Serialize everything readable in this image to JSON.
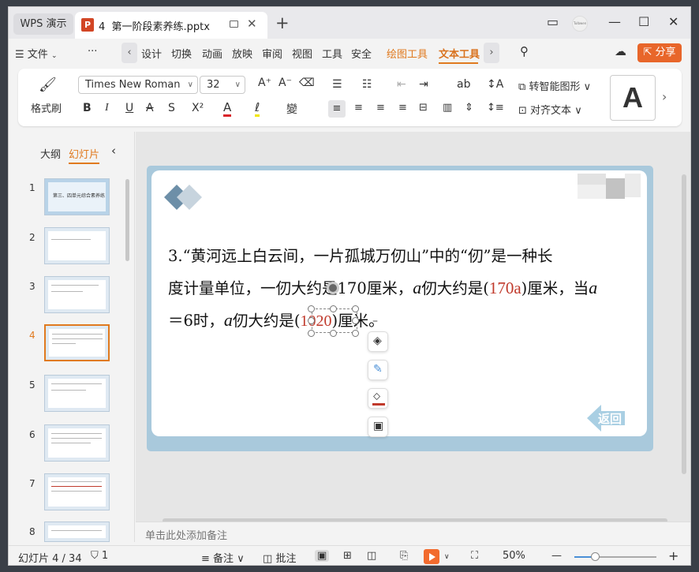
{
  "app": {
    "name": "WPS 演示"
  },
  "tab": {
    "number": "4",
    "title": "第一阶段素养练.pptx",
    "avatar_text": "Tulbwen"
  },
  "menu": {
    "file": "文件",
    "more": "···",
    "items": [
      "设计",
      "切换",
      "动画",
      "放映",
      "审阅",
      "视图",
      "工具",
      "安全"
    ],
    "drawing_tools": "绘图工具",
    "text_tools": "文本工具",
    "share": "分享"
  },
  "ribbon": {
    "format_painter": "格式刷",
    "font": "Times New Roman",
    "size": "32",
    "convert_shape": "转智能图形",
    "align_text": "对齐文本",
    "style_preview": "A"
  },
  "panel": {
    "outline_tab": "大纲",
    "slides_tab": "幻灯片",
    "thumbnails": [
      "1",
      "2",
      "3",
      "4",
      "5",
      "6",
      "7",
      "8"
    ],
    "current_index": 4,
    "thumb1_title": "第三、四单元综合素养练"
  },
  "slide": {
    "line1": "3.“黄河远上白云间，一片孤城万仞山”中的“仞”是一种长",
    "line2a": "度计量单位，一仞大约是170厘米，",
    "var_a": "a",
    "line2b": "仞大约是(",
    "answer1": "170a",
    "line2c": ")厘米，当",
    "line3a": "＝6时，",
    "line3b": "仞大约是(",
    "answer2": "1020",
    "line3c": ")厘米。",
    "return_btn": "返回"
  },
  "notes": {
    "placeholder": "单击此处添加备注"
  },
  "status": {
    "slide_counter": "幻灯片 4 / 34",
    "pending": "1",
    "notes": "备注",
    "comments": "批注",
    "zoom": "50%"
  },
  "colors": {
    "accent": "#e07a1f",
    "play": "#f26b2e",
    "share": "#e8662a",
    "answer": "#c0392b"
  },
  "zoom_level": 0.25
}
